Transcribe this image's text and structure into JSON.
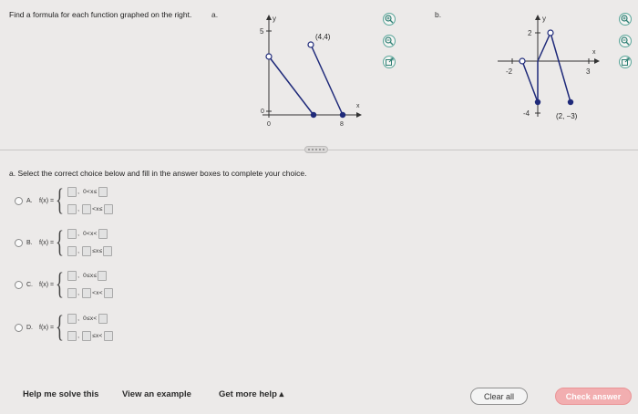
{
  "question": "Find a formula for each function graphed on the right.",
  "part_a_label": "a.",
  "part_b_label": "b.",
  "graph_a": {
    "y_axis_label": "y",
    "x_axis_label": "x",
    "tick_y_top": "5",
    "tick_y_zero": "0",
    "tick_x_origin": "0",
    "tick_x_right": "8",
    "point_label": "(4,4)"
  },
  "graph_b": {
    "y_axis_label": "y",
    "x_axis_label": "x",
    "tick_y_top": "2",
    "tick_y_bottom": "-4",
    "tick_x_left": "-2",
    "tick_x_right": "3",
    "point_label": "(2, −3)"
  },
  "instruction": "a. Select the correct choice below and fill in the answer boxes to complete your choice.",
  "choices": [
    {
      "letter": "A.",
      "fx": "f(x) =",
      "cond1": "0<x≤",
      "cond2": "<x≤"
    },
    {
      "letter": "B.",
      "fx": "f(x) =",
      "cond1": "0<x<",
      "cond2": "≤x≤"
    },
    {
      "letter": "C.",
      "fx": "f(x) =",
      "cond1": "0≤x≤",
      "cond2": "<x<"
    },
    {
      "letter": "D.",
      "fx": "f(x) =",
      "cond1": "0≤x<",
      "cond2": "≤x<"
    }
  ],
  "footer": {
    "help": "Help me solve this",
    "example": "View an example",
    "more_help": "Get more help ▴",
    "clear": "Clear all",
    "check": "Check answer"
  },
  "colors": {
    "line": "#1f2a7a",
    "dot": "#1f2a7a",
    "icon": "#5aa69a",
    "check_button": "#f2aeb0"
  },
  "icons": [
    "zoom-in-icon",
    "zoom-out-icon",
    "popout-icon"
  ]
}
